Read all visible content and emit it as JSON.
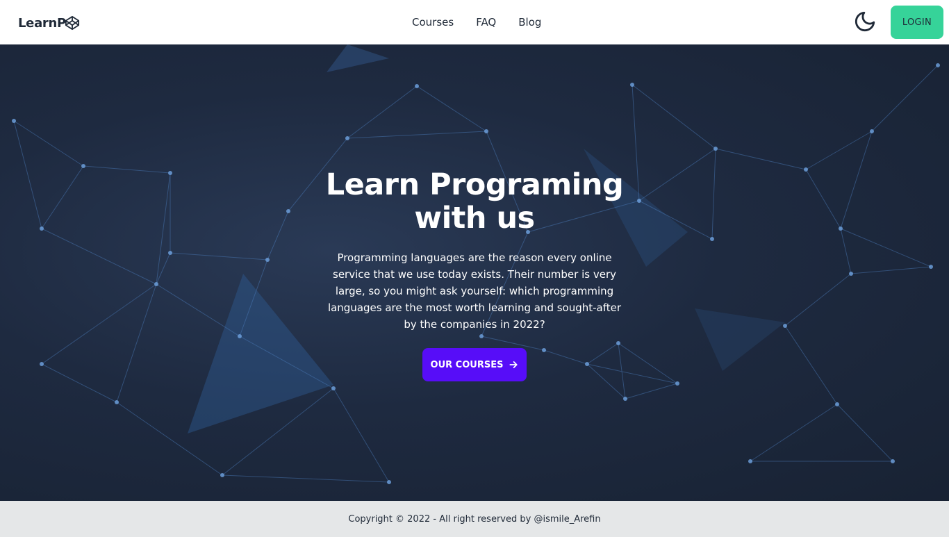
{
  "nav": {
    "brand": "LearnP",
    "brand_icon": "codepen-cube-icon",
    "links": [
      "Courses",
      "FAQ",
      "Blog"
    ],
    "theme_icon": "moon-icon",
    "login_label": "LOGIN",
    "login_color": "#36d399"
  },
  "hero": {
    "title_line1": "Learn Programing",
    "title_line2": "with us",
    "description": "Programming languages are the reason every online service that we use today exists. Their number is very large, so you might ask yourself: which programming languages are the most worth learning and sought-after by the companies in 2022?",
    "cta_label": "OUR COURSES",
    "cta_icon": "arrow-right-icon",
    "cta_color": "#570df8",
    "background": "network-graph-image"
  },
  "footer": {
    "copyright": "Copyright © 2022 - All right reserved by @ismile_Arefin"
  }
}
